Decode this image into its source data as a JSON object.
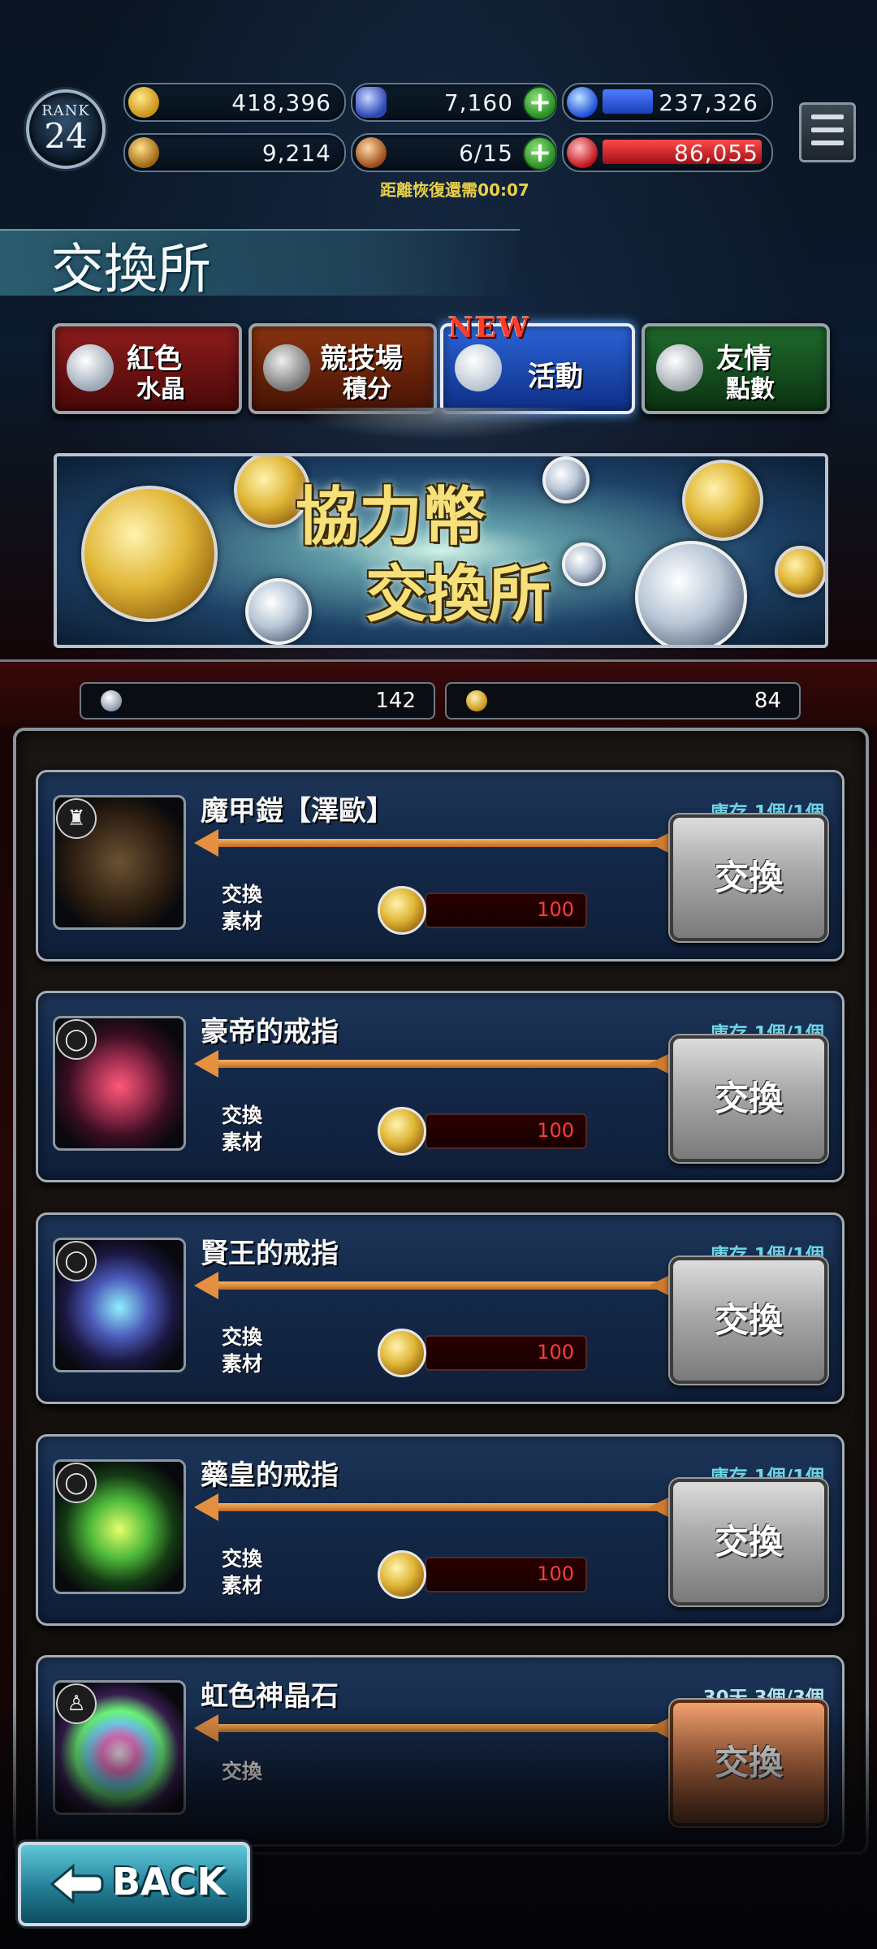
{
  "hud": {
    "rank_label": "RANK",
    "rank_value": "24",
    "gil": "418,396",
    "crystal": "7,160",
    "blue_orb": "237,326",
    "blue_orb_fill": 0.35,
    "medal": "9,214",
    "stamina": "6/15",
    "red_orb": "86,055",
    "red_orb_fill": 0.95,
    "recover_timer": "距離恢復還需00:07"
  },
  "title": "交換所",
  "tabs": [
    {
      "line1": "紅色",
      "line2": "水晶"
    },
    {
      "line1": "競技場",
      "line2": "積分"
    },
    {
      "label": "活動",
      "badge": "NEW"
    },
    {
      "line1": "友情",
      "line2": "點數"
    }
  ],
  "banner": {
    "line1": "協力幣",
    "line2": "交換所"
  },
  "materials": [
    {
      "value": "142",
      "color": "#b8c6d6"
    },
    {
      "value": "84",
      "color": "#e0b636"
    }
  ],
  "items": [
    {
      "name": "魔甲鎧【澤歐】",
      "stock": "庫存 1個/1個",
      "mat_label": "交換\n素材",
      "cost": "100",
      "button": "交換",
      "cat_icon": "armor-icon"
    },
    {
      "name": "豪帝的戒指",
      "stock": "庫存 1個/1個",
      "mat_label": "交換\n素材",
      "cost": "100",
      "button": "交換",
      "cat_icon": "ring-icon"
    },
    {
      "name": "賢王的戒指",
      "stock": "庫存 1個/1個",
      "mat_label": "交換\n素材",
      "cost": "100",
      "button": "交換",
      "cat_icon": "ring-icon"
    },
    {
      "name": "藥皇的戒指",
      "stock": "庫存 1個/1個",
      "mat_label": "交換\n素材",
      "cost": "100",
      "button": "交換",
      "cat_icon": "ring-icon"
    },
    {
      "name": "虹色神晶石",
      "stock": "30天 3個/3個",
      "mat_label": "交換",
      "button": "交換",
      "cat_icon": "material-icon"
    }
  ],
  "back_label": "BACK"
}
